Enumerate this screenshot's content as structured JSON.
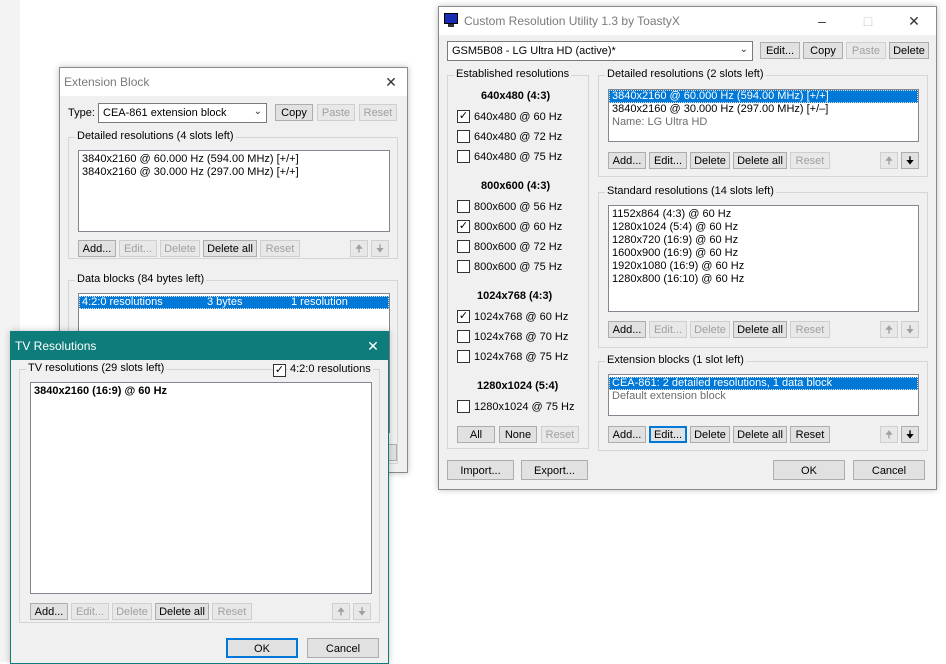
{
  "main": {
    "title": "Custom Resolution Utility 1.3 by ToastyX",
    "monitor": "GSM5B08 - LG Ultra HD (active)*",
    "top_buttons": [
      "Edit...",
      "Copy",
      "Paste",
      "Delete"
    ],
    "established": {
      "label": "Established resolutions",
      "groups": [
        {
          "heading": "640x480 (4:3)",
          "items": [
            {
              "label": "640x480 @ 60 Hz",
              "checked": true
            },
            {
              "label": "640x480 @ 72 Hz",
              "checked": false
            },
            {
              "label": "640x480 @ 75 Hz",
              "checked": false
            }
          ]
        },
        {
          "heading": "800x600 (4:3)",
          "items": [
            {
              "label": "800x600 @ 56 Hz",
              "checked": false
            },
            {
              "label": "800x600 @ 60 Hz",
              "checked": true
            },
            {
              "label": "800x600 @ 72 Hz",
              "checked": false
            },
            {
              "label": "800x600 @ 75 Hz",
              "checked": false
            }
          ]
        },
        {
          "heading": "1024x768 (4:3)",
          "items": [
            {
              "label": "1024x768 @ 60 Hz",
              "checked": true
            },
            {
              "label": "1024x768 @ 70 Hz",
              "checked": false
            },
            {
              "label": "1024x768 @ 75 Hz",
              "checked": false
            }
          ]
        },
        {
          "heading": "1280x1024 (5:4)",
          "items": [
            {
              "label": "1280x1024 @ 75 Hz",
              "checked": false
            }
          ]
        }
      ],
      "buttons": [
        "All",
        "None",
        "Reset"
      ]
    },
    "detailed": {
      "label": "Detailed resolutions (2 slots left)",
      "items": [
        "3840x2160 @ 60.000 Hz (594.00 MHz) [+/+]",
        "3840x2160 @ 30.000 Hz (297.00 MHz) [+/–]",
        "Name: LG Ultra HD"
      ],
      "buttons": [
        "Add...",
        "Edit...",
        "Delete",
        "Delete all",
        "Reset"
      ]
    },
    "standard": {
      "label": "Standard resolutions (14 slots left)",
      "items": [
        "1152x864 (4:3) @ 60 Hz",
        "1280x1024 (5:4) @ 60 Hz",
        "1280x720 (16:9) @ 60 Hz",
        "1600x900 (16:9) @ 60 Hz",
        "1920x1080 (16:9) @ 60 Hz",
        "1280x800 (16:10) @ 60 Hz"
      ],
      "buttons": [
        "Add...",
        "Edit...",
        "Delete",
        "Delete all",
        "Reset"
      ]
    },
    "extension": {
      "label": "Extension blocks (1 slot left)",
      "items": [
        "CEA-861: 2 detailed resolutions, 1 data block",
        "Default extension block"
      ],
      "buttons": [
        "Add...",
        "Edit...",
        "Delete",
        "Delete all",
        "Reset"
      ]
    },
    "bottom_buttons": [
      "Import...",
      "Export...",
      "OK",
      "Cancel"
    ]
  },
  "ext": {
    "title": "Extension Block",
    "type_label": "Type:",
    "type_value": "CEA-861 extension block",
    "type_buttons": [
      "Copy",
      "Paste",
      "Reset"
    ],
    "detailed": {
      "label": "Detailed resolutions (4 slots left)",
      "items": [
        "3840x2160 @ 60.000 Hz (594.00 MHz) [+/+]",
        "3840x2160 @ 30.000 Hz (297.00 MHz) [+/+]"
      ],
      "buttons": [
        "Add...",
        "Edit...",
        "Delete",
        "Delete all",
        "Reset"
      ]
    },
    "data_blocks": {
      "label": "Data blocks (84 bytes left)",
      "row": {
        "type": "4:2:0 resolutions",
        "size": "3 bytes",
        "info": "1 resolution"
      }
    }
  },
  "tv": {
    "title": "TV Resolutions",
    "list_label": "TV resolutions (29 slots left)",
    "checkbox_label": "4:2:0 resolutions",
    "items": [
      "3840x2160 (16:9) @ 60 Hz"
    ],
    "buttons": [
      "Add...",
      "Edit...",
      "Delete",
      "Delete all",
      "Reset"
    ],
    "ok": "OK",
    "cancel": "Cancel"
  },
  "icons": {
    "minimize": "minimize-icon",
    "maximize": "maximize-icon",
    "close": "close-icon",
    "up": "arrow-up-icon",
    "down": "arrow-down-icon",
    "app": "monitor-icon"
  },
  "colors": {
    "selection": "#0078d7",
    "tv_titlebar": "#0f7c7c",
    "window_bg": "#f0f0f0"
  }
}
